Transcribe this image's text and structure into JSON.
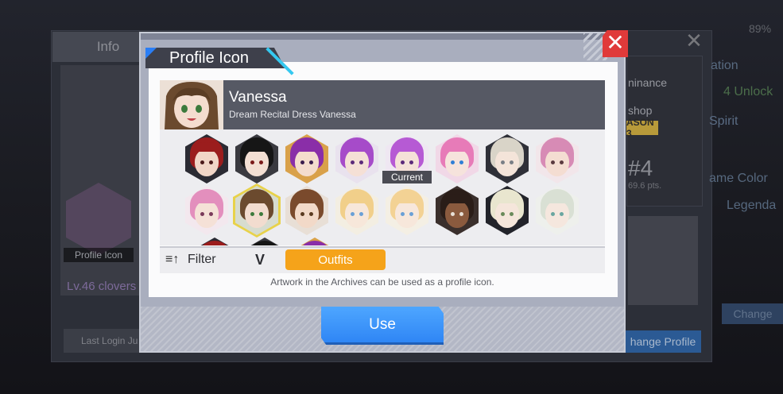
{
  "background": {
    "info_tab": "Info",
    "profile_icon_label": "Profile Icon",
    "level_text": "Lv.46 clovers",
    "last_login": "Last Login Ju",
    "right_text_1": "ninance",
    "right_text_2": "shop",
    "season": "ASON 3",
    "rank": "#4",
    "pts": "69.6 pts.",
    "far_right_1": "ation",
    "far_right_2": "4 Unlock",
    "far_right_3": "Spirit",
    "far_right_4": "ame Color",
    "far_right_5": "Legenda",
    "percent": "89%",
    "change_profile": "hange Profile",
    "change": "Change",
    "close_glyph": "✕"
  },
  "modal": {
    "title": "Profile Icon",
    "close_glyph": "✕",
    "selected": {
      "name": "Vanessa",
      "description": "Dream Recital Dress Vanessa"
    },
    "current_badge": "Current",
    "filter_label": "Filter",
    "filter_icon": "≡↑",
    "filter_chevron": "V",
    "outfits_label": "Outfits",
    "footer_note": "Artwork in the Archives can be used as a profile icon.",
    "use_label": "Use",
    "icons_row1": [
      {
        "hair": "#9b1d1d",
        "skin": "#f1d6c7",
        "eye": "#4b1a1a",
        "bg": "#2b2b33"
      },
      {
        "hair": "#161616",
        "skin": "#f3dfd3",
        "eye": "#7a1a1a",
        "bg": "#3a3a40"
      },
      {
        "hair": "#8a2ea8",
        "skin": "#f4dccd",
        "eye": "#3a1d4d",
        "bg": "#d9a14a"
      },
      {
        "hair": "#a64bc9",
        "skin": "#f5e0d6",
        "eye": "#5b2a7a",
        "bg": "#e9e2ee"
      },
      {
        "hair": "#b65ad4",
        "skin": "#f5e1d8",
        "eye": "#5b2a7a",
        "bg": "#efe7f2"
      },
      {
        "hair": "#e77bb8",
        "skin": "#f6e3dc",
        "eye": "#2f7fd6",
        "bg": "#f1d8e7"
      },
      {
        "hair": "#d9d4c8",
        "skin": "#f4e4d9",
        "eye": "#7a7f86",
        "bg": "#2f3038"
      },
      {
        "hair": "#d78bb5",
        "skin": "#f4ddd2",
        "eye": "#5a3a40",
        "bg": "#f2e6ea"
      }
    ],
    "icons_row2": [
      {
        "hair": "#e38fbd",
        "skin": "#f5e1d7",
        "eye": "#7a3a5a",
        "bg": "#f3e8ee"
      },
      {
        "hair": "#6b4a2e",
        "skin": "#f2dccf",
        "eye": "#3c7a3c",
        "bg": "#d7dccf"
      },
      {
        "hair": "#7a4a2c",
        "skin": "#f2d9c8",
        "eye": "#5a3a20",
        "bg": "#e8dfd6"
      },
      {
        "hair": "#f1cf8a",
        "skin": "#f7e7da",
        "eye": "#6aa0d6",
        "bg": "#f3eee2"
      },
      {
        "hair": "#f3d294",
        "skin": "#f7e7db",
        "eye": "#6aa0d6",
        "bg": "#f4efe4"
      },
      {
        "hair": "#2a1d18",
        "skin": "#8a5a3e",
        "eye": "#e9e1d8",
        "bg": "#3a2f2c"
      },
      {
        "hair": "#e9e6cf",
        "skin": "#f5e6db",
        "eye": "#6a8a5a",
        "bg": "#22232a"
      },
      {
        "hair": "#d9e0d4",
        "skin": "#f5e7de",
        "eye": "#6aa6a0",
        "bg": "#eef0ec"
      }
    ]
  }
}
